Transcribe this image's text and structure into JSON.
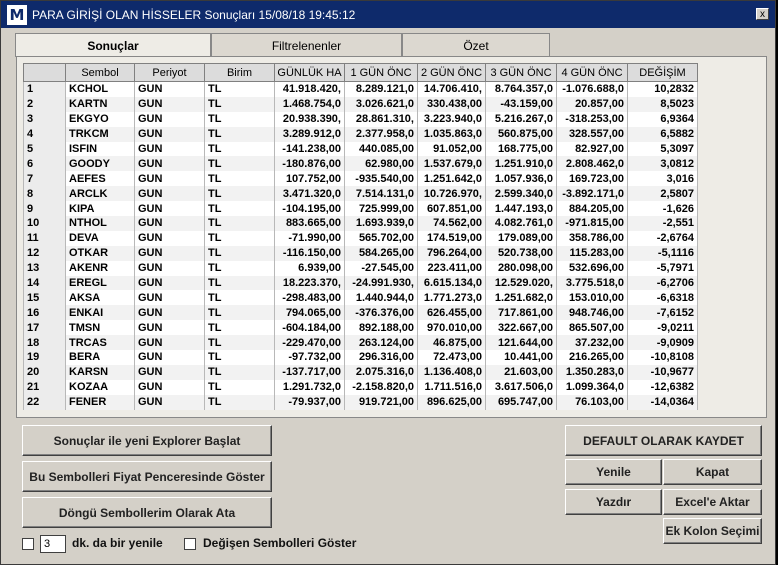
{
  "window": {
    "title": "PARA GİRİŞİ OLAN HİSSELER Sonuçları 15/08/18 19:45:12",
    "icon_letter": "M",
    "close_symbol": "x"
  },
  "tabs": [
    {
      "label": "Sonuçlar",
      "active": true
    },
    {
      "label": "Filtrelenenler",
      "active": false
    },
    {
      "label": "Özet",
      "active": false
    }
  ],
  "table": {
    "columns": [
      "",
      "Sembol",
      "Periyot",
      "Birim",
      "GÜNLÜK HA",
      "1 GÜN ÖNC",
      "2 GÜN ÖNC",
      "3 GÜN ÖNC",
      "4 GÜN ÖNC",
      "DEĞİŞİM"
    ],
    "rows": [
      [
        "1",
        "KCHOL",
        "GUN",
        "TL",
        "41.918.420,",
        "8.289.121,0",
        "14.706.410,",
        "8.764.357,0",
        "-1.076.688,0",
        "10,2832"
      ],
      [
        "2",
        "KARTN",
        "GUN",
        "TL",
        "1.468.754,0",
        "3.026.621,0",
        "330.438,00",
        "-43.159,00",
        "20.857,00",
        "8,5023"
      ],
      [
        "3",
        "EKGYO",
        "GUN",
        "TL",
        "20.938.390,",
        "28.861.310,",
        "3.223.940,0",
        "5.216.267,0",
        "-318.253,00",
        "6,9364"
      ],
      [
        "4",
        "TRKCM",
        "GUN",
        "TL",
        "3.289.912,0",
        "2.377.958,0",
        "1.035.863,0",
        "560.875,00",
        "328.557,00",
        "6,5882"
      ],
      [
        "5",
        "ISFIN",
        "GUN",
        "TL",
        "-141.238,00",
        "440.085,00",
        "91.052,00",
        "168.775,00",
        "82.927,00",
        "5,3097"
      ],
      [
        "6",
        "GOODY",
        "GUN",
        "TL",
        "-180.876,00",
        "62.980,00",
        "1.537.679,0",
        "1.251.910,0",
        "2.808.462,0",
        "3,0812"
      ],
      [
        "7",
        "AEFES",
        "GUN",
        "TL",
        "107.752,00",
        "-935.540,00",
        "1.251.642,0",
        "1.057.936,0",
        "169.723,00",
        "3,016"
      ],
      [
        "8",
        "ARCLK",
        "GUN",
        "TL",
        "3.471.320,0",
        "7.514.131,0",
        "10.726.970,",
        "2.599.340,0",
        "-3.892.171,0",
        "2,5807"
      ],
      [
        "9",
        "KIPA",
        "GUN",
        "TL",
        "-104.195,00",
        "725.999,00",
        "607.851,00",
        "1.447.193,0",
        "884.205,00",
        "-1,626"
      ],
      [
        "10",
        "NTHOL",
        "GUN",
        "TL",
        "883.665,00",
        "1.693.939,0",
        "74.562,00",
        "4.082.761,0",
        "-971.815,00",
        "-2,551"
      ],
      [
        "11",
        "DEVA",
        "GUN",
        "TL",
        "-71.990,00",
        "565.702,00",
        "174.519,00",
        "179.089,00",
        "358.786,00",
        "-2,6764"
      ],
      [
        "12",
        "OTKAR",
        "GUN",
        "TL",
        "-116.150,00",
        "584.265,00",
        "796.264,00",
        "520.738,00",
        "115.283,00",
        "-5,1116"
      ],
      [
        "13",
        "AKENR",
        "GUN",
        "TL",
        "6.939,00",
        "-27.545,00",
        "223.411,00",
        "280.098,00",
        "532.696,00",
        "-5,7971"
      ],
      [
        "14",
        "EREGL",
        "GUN",
        "TL",
        "18.223.370,",
        "-24.991.930,",
        "6.615.134,0",
        "12.529.020,",
        "3.775.518,0",
        "-6,2706"
      ],
      [
        "15",
        "AKSA",
        "GUN",
        "TL",
        "-298.483,00",
        "1.440.944,0",
        "1.771.273,0",
        "1.251.682,0",
        "153.010,00",
        "-6,6318"
      ],
      [
        "16",
        "ENKAI",
        "GUN",
        "TL",
        "794.065,00",
        "-376.376,00",
        "626.455,00",
        "717.861,00",
        "948.746,00",
        "-7,6152"
      ],
      [
        "17",
        "TMSN",
        "GUN",
        "TL",
        "-604.184,00",
        "892.188,00",
        "970.010,00",
        "322.667,00",
        "865.507,00",
        "-9,0211"
      ],
      [
        "18",
        "TRCAS",
        "GUN",
        "TL",
        "-229.470,00",
        "263.124,00",
        "46.875,00",
        "121.644,00",
        "37.232,00",
        "-9,0909"
      ],
      [
        "19",
        "BERA",
        "GUN",
        "TL",
        "-97.732,00",
        "296.316,00",
        "72.473,00",
        "10.441,00",
        "216.265,00",
        "-10,8108"
      ],
      [
        "20",
        "KARSN",
        "GUN",
        "TL",
        "-137.717,00",
        "2.075.316,0",
        "1.136.408,0",
        "21.603,00",
        "1.350.283,0",
        "-10,9677"
      ],
      [
        "21",
        "KOZAA",
        "GUN",
        "TL",
        "1.291.732,0",
        "-2.158.820,0",
        "1.711.516,0",
        "3.617.506,0",
        "1.099.364,0",
        "-12,6382"
      ],
      [
        "22",
        "FENER",
        "GUN",
        "TL",
        "-79.937,00",
        "919.721,00",
        "896.625,00",
        "695.747,00",
        "76.103,00",
        "-14,0364"
      ]
    ]
  },
  "buttons": {
    "explorer": "Sonuçlar ile yeni Explorer Başlat",
    "price_window": "Bu Sembolleri Fiyat Penceresinde Göster",
    "loop_symbols": "Döngü Sembollerim Olarak Ata",
    "default_save": "DEFAULT OLARAK KAYDET",
    "refresh": "Yenile",
    "close": "Kapat",
    "print": "Yazdır",
    "excel": "Excel'e Aktar",
    "extra_column": "Ek Kolon Seçimi"
  },
  "options": {
    "auto_refresh_minutes": "3",
    "auto_refresh_label": "dk. da bir yenile",
    "show_changed_label": "Değişen Sembolleri Göster"
  }
}
